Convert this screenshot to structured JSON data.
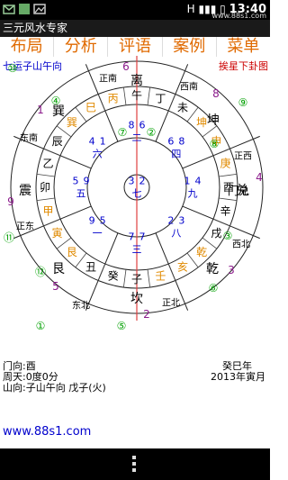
{
  "status_bar": {
    "network": "H",
    "signal_icon": "signal-icon",
    "battery_icon": "battery-icon",
    "time": "13:40",
    "site": "www.88s1.com"
  },
  "app_title": "三元风水专家",
  "menu": [
    {
      "label": "布局"
    },
    {
      "label": "分析"
    },
    {
      "label": "评语"
    },
    {
      "label": "案例"
    },
    {
      "label": "菜单"
    }
  ],
  "header": {
    "left": "七运子山午向",
    "right": "挨星下卦图"
  },
  "rings": {
    "outer_texts": [
      {
        "t": "正南"
      },
      {
        "t": "西南"
      },
      {
        "t": "正西"
      },
      {
        "t": "西北"
      },
      {
        "t": "正北"
      },
      {
        "t": "东北"
      },
      {
        "t": "正东"
      },
      {
        "t": "东南"
      }
    ],
    "gua": [
      {
        "t": "离"
      },
      {
        "t": "坤"
      },
      {
        "t": "兑"
      },
      {
        "t": "乾"
      },
      {
        "t": "坎"
      },
      {
        "t": "艮"
      },
      {
        "t": "震"
      },
      {
        "t": "巽"
      }
    ],
    "gua_nums": [
      {
        "t": "6"
      },
      {
        "t": "8"
      },
      {
        "t": "4"
      },
      {
        "t": "3"
      },
      {
        "t": "2"
      },
      {
        "t": "5"
      },
      {
        "t": "9"
      },
      {
        "t": "1"
      }
    ],
    "mountains": [
      {
        "t": "丙"
      },
      {
        "t": "午"
      },
      {
        "t": "丁"
      },
      {
        "t": "未"
      },
      {
        "t": "坤"
      },
      {
        "t": "申"
      },
      {
        "t": "庚"
      },
      {
        "t": "酉"
      },
      {
        "t": "辛"
      },
      {
        "t": "戌"
      },
      {
        "t": "乾"
      },
      {
        "t": "亥"
      },
      {
        "t": "壬"
      },
      {
        "t": "子"
      },
      {
        "t": "癸"
      },
      {
        "t": "丑"
      },
      {
        "t": "艮"
      },
      {
        "t": "寅"
      },
      {
        "t": "甲"
      },
      {
        "t": "卯"
      },
      {
        "t": "乙"
      },
      {
        "t": "辰"
      },
      {
        "t": "巽"
      },
      {
        "t": "巳"
      }
    ],
    "palaces": [
      {
        "a": "4",
        "b": "1",
        "c": "六"
      },
      {
        "a": "8",
        "b": "6",
        "c": "二"
      },
      {
        "a": "6",
        "b": "8",
        "c": "四"
      },
      {
        "a": "5",
        "b": "9",
        "c": "五"
      },
      {
        "a": "3",
        "b": "2",
        "c": "七"
      },
      {
        "a": "1",
        "b": "4",
        "c": "九"
      },
      {
        "a": "9",
        "b": "5",
        "c": "一"
      },
      {
        "a": "7",
        "b": "7",
        "c": "三"
      },
      {
        "a": "2",
        "b": "3",
        "c": "八"
      }
    ],
    "circle_labels": [
      {
        "t": "⑩"
      },
      {
        "t": "④"
      },
      {
        "t": "⑪"
      },
      {
        "t": "⑫"
      },
      {
        "t": "①"
      },
      {
        "t": "⑤"
      },
      {
        "t": "⑥"
      },
      {
        "t": "⑧"
      },
      {
        "t": "⑨"
      },
      {
        "t": "③"
      },
      {
        "t": "⑦"
      },
      {
        "t": "②"
      }
    ]
  },
  "door": "门兑",
  "info": {
    "left1": "门向:酉",
    "left2": "周天:0度0分",
    "left3": "山向:子山午向 戊子(火)",
    "right1": "癸巳年",
    "right2": "2013年寅月"
  },
  "website": "www.88s1.com"
}
